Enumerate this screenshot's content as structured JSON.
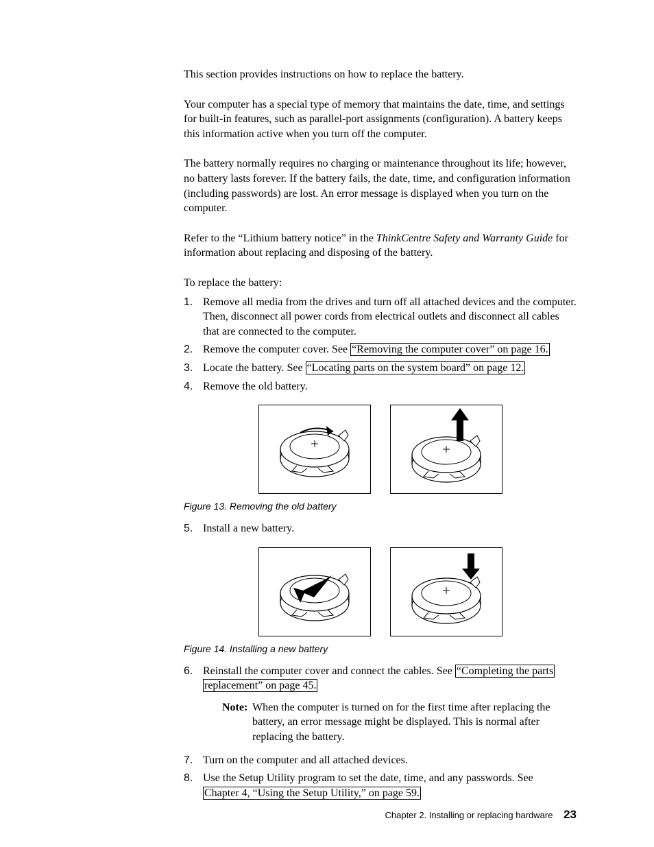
{
  "para1": "This section provides instructions on how to replace the battery.",
  "para2": "Your computer has a special type of memory that maintains the date, time, and settings for built-in features, such as parallel-port assignments (configuration). A battery keeps this information active when you turn off the computer.",
  "para3": "The battery normally requires no charging or maintenance throughout its life; however, no battery lasts forever. If the battery fails, the date, time, and configuration information (including passwords) are lost. An error message is displayed when you turn on the computer.",
  "para4_pre": "Refer to the “Lithium battery notice” in the ",
  "para4_italic": "ThinkCentre Safety and Warranty Guide",
  "para4_post": " for information about replacing and disposing of the battery.",
  "intro": "To replace the battery:",
  "steps": {
    "s1": {
      "num": "1.",
      "text": "Remove all media from the drives and turn off all attached devices and the computer. Then, disconnect all power cords from electrical outlets and disconnect all cables that are connected to the computer."
    },
    "s2": {
      "num": "2.",
      "pre": "Remove the computer cover. See ",
      "link": "“Removing the computer cover” on page 16."
    },
    "s3": {
      "num": "3.",
      "pre": "Locate the battery. See ",
      "link": "“Locating parts on the system board” on page 12."
    },
    "s4": {
      "num": "4.",
      "text": "Remove the old battery."
    },
    "s5": {
      "num": "5.",
      "text": "Install a new battery."
    },
    "s6": {
      "num": "6.",
      "pre": "Reinstall the computer cover and connect the cables. See ",
      "link1": "“Completing the parts",
      "link2": "replacement” on page 45."
    },
    "s7": {
      "num": "7.",
      "text": "Turn on the computer and all attached devices."
    },
    "s8": {
      "num": "8.",
      "pre": "Use the Setup Utility program to set the date, time, and any passwords. See ",
      "link": "Chapter 4, “Using the Setup Utility,” on page 59."
    }
  },
  "note": {
    "label": "Note:",
    "text": "When the computer is turned on for the first time after replacing the battery, an error message might be displayed. This is normal after replacing the battery."
  },
  "caption1": "Figure 13. Removing the old battery",
  "caption2": "Figure 14. Installing a new battery",
  "footer": {
    "chapter": "Chapter 2. Installing or replacing hardware",
    "page": "23"
  }
}
